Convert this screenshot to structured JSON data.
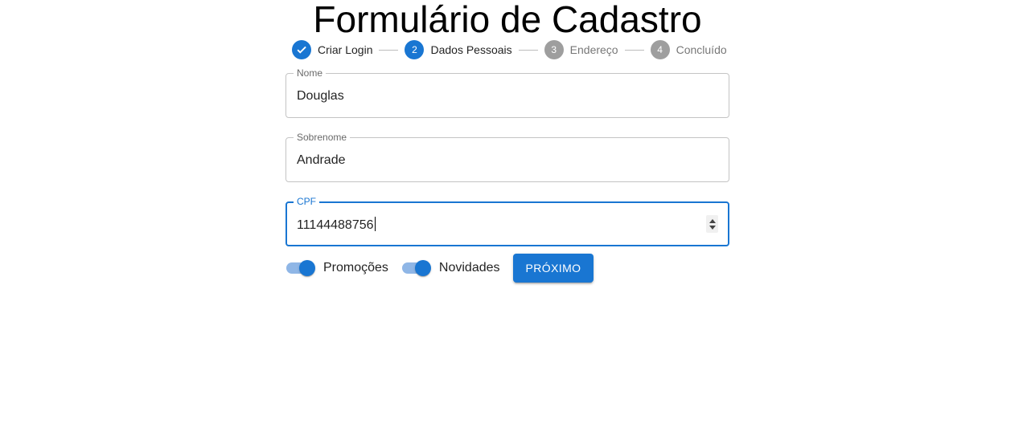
{
  "page": {
    "title": "Formulário de Cadastro"
  },
  "stepper": {
    "steps": [
      {
        "label": "Criar Login",
        "number": "1",
        "state": "completed",
        "icon": "check-icon"
      },
      {
        "label": "Dados Pessoais",
        "number": "2",
        "state": "active"
      },
      {
        "label": "Endereço",
        "number": "3",
        "state": "pending"
      },
      {
        "label": "Concluído",
        "number": "4",
        "state": "pending"
      }
    ]
  },
  "form": {
    "nome": {
      "label": "Nome",
      "value": "Douglas"
    },
    "sobrenome": {
      "label": "Sobrenome",
      "value": "Andrade"
    },
    "cpf": {
      "label": "CPF",
      "value": "11144488756"
    }
  },
  "toggles": {
    "promocoes": {
      "label": "Promoções",
      "checked": true
    },
    "novidades": {
      "label": "Novidades",
      "checked": true
    }
  },
  "actions": {
    "next_label": "PRÓXIMO"
  },
  "colors": {
    "primary": "#1976d2",
    "inactive_step": "#9e9e9e",
    "switch_track": "#8fb6e6"
  }
}
